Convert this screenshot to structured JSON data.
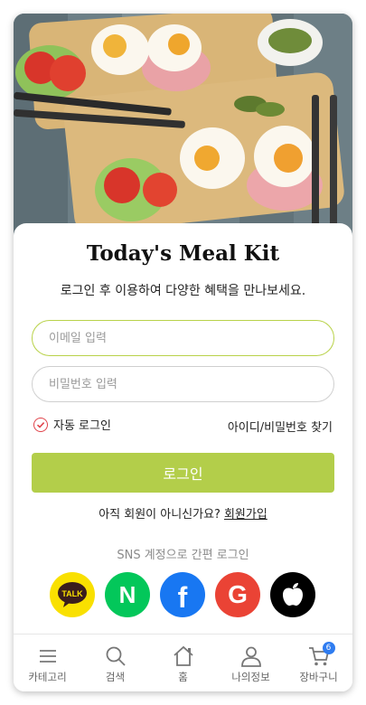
{
  "app": {
    "title": "Today's Meal Kit",
    "subtitle": "로그인 후 이용하여 다양한 혜택을 만나보세요."
  },
  "form": {
    "email_placeholder": "이메일 입력",
    "email_value": "",
    "password_placeholder": "비밀번호 입력",
    "password_value": "",
    "auto_login_label": "자동 로그인",
    "auto_login_checked": true,
    "find_account_label": "아이디/비밀번호 찾기",
    "login_button_label": "로그인"
  },
  "signup": {
    "prompt": "아직 회원이 아니신가요?",
    "link_label": "회원가입"
  },
  "sns": {
    "label": "SNS 계정으로 간편 로그인",
    "kakao_text": "TALK",
    "naver_text": "N",
    "facebook_text": "f",
    "google_text": "G"
  },
  "tabbar": {
    "items": [
      {
        "label": "카테고리",
        "icon": "menu-icon"
      },
      {
        "label": "검색",
        "icon": "search-icon"
      },
      {
        "label": "홈",
        "icon": "home-icon"
      },
      {
        "label": "나의정보",
        "icon": "user-icon"
      },
      {
        "label": "장바구니",
        "icon": "cart-icon"
      }
    ],
    "cart_count": "6"
  },
  "colors": {
    "accent": "#b3ce4a",
    "check": "#e0434a",
    "badge": "#2f7cf0"
  }
}
